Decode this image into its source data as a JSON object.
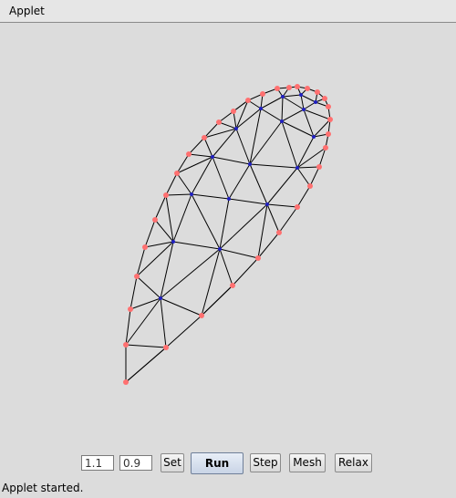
{
  "menubar": {
    "title": "Applet"
  },
  "controls": {
    "field1_value": "1.1",
    "field2_value": "0.9",
    "set_label": "Set",
    "run_label": "Run",
    "step_label": "Step",
    "mesh_label": "Mesh",
    "relax_label": "Relax"
  },
  "status": {
    "text": "Applet started."
  },
  "colors": {
    "boundary_node": "#ff7070",
    "interior_node": "#2020c0",
    "edge": "#000000"
  }
}
